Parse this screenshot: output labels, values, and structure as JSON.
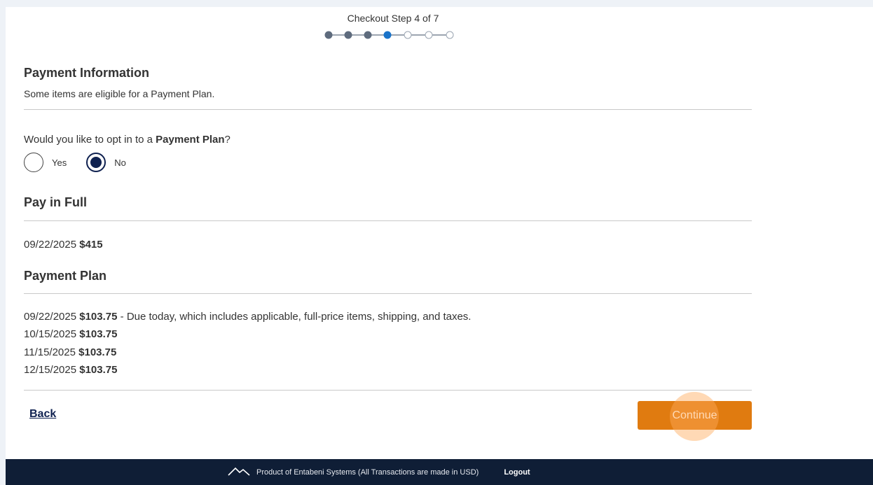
{
  "checkout": {
    "step_title": "Checkout Step 4 of 7",
    "current_step": 4,
    "total_steps": 7
  },
  "payment_info": {
    "heading": "Payment Information",
    "subtitle": "Some items are eligible for a Payment Plan."
  },
  "opt_in": {
    "question_prefix": "Would you like to opt in to a ",
    "question_bold": "Payment Plan",
    "question_suffix": "?",
    "options": [
      {
        "label": "Yes",
        "selected": false
      },
      {
        "label": "No",
        "selected": true
      }
    ]
  },
  "pay_in_full": {
    "heading": "Pay in Full",
    "date": "09/22/2025",
    "amount": "$415"
  },
  "payment_plan": {
    "heading": "Payment Plan",
    "installments": [
      {
        "date": "09/22/2025",
        "amount": "$103.75",
        "note": " - Due today, which includes applicable, full-price items, shipping, and taxes."
      },
      {
        "date": "10/15/2025",
        "amount": "$103.75",
        "note": ""
      },
      {
        "date": "11/15/2025",
        "amount": "$103.75",
        "note": ""
      },
      {
        "date": "12/15/2025",
        "amount": "$103.75",
        "note": ""
      }
    ]
  },
  "actions": {
    "back_label": "Back",
    "continue_label": "Continue"
  },
  "footer": {
    "text": "Product of Entabeni Systems (All Transactions are made in USD)",
    "logout_label": "Logout"
  },
  "colors": {
    "accent_orange": "#e07b10",
    "navy": "#0f2150",
    "footer_bg": "#0f1e36",
    "step_complete": "#5e6b7d",
    "step_current": "#1a73c9"
  }
}
